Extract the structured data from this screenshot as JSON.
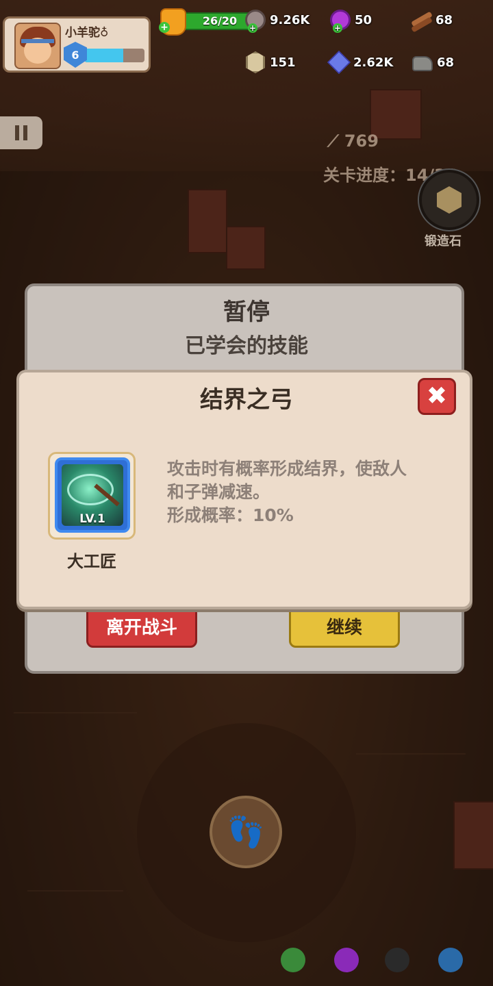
{
  "player": {
    "name": "小羊驼♁",
    "level": "6",
    "xp_fraction": 0.65
  },
  "resources": {
    "energy": "26/20",
    "gear": "9.26K",
    "orb": "50",
    "wood": "68",
    "coin": "151",
    "gem": "2.62K",
    "stone": "68"
  },
  "battle": {
    "kills": "769",
    "progress_label": "关卡进度：14/36",
    "forge_label": "锻造石"
  },
  "pause_panel": {
    "title": "暂停",
    "subtitle": "已学会的技能",
    "leave_label": "离开战斗",
    "continue_label": "继续"
  },
  "skill_popup": {
    "title": "结界之弓",
    "skill_level": "LV.1",
    "skill_name": "大工匠",
    "desc_line1": "攻击时有概率形成结界，使敌人",
    "desc_line2": "和子弹减速。",
    "desc_line3": "形成概率：10%"
  },
  "colors": {
    "close_red": "#d8413f",
    "leave_red": "#d23b3b",
    "continue_yellow": "#e6c13a",
    "xp_blue": "#44c6ee"
  }
}
